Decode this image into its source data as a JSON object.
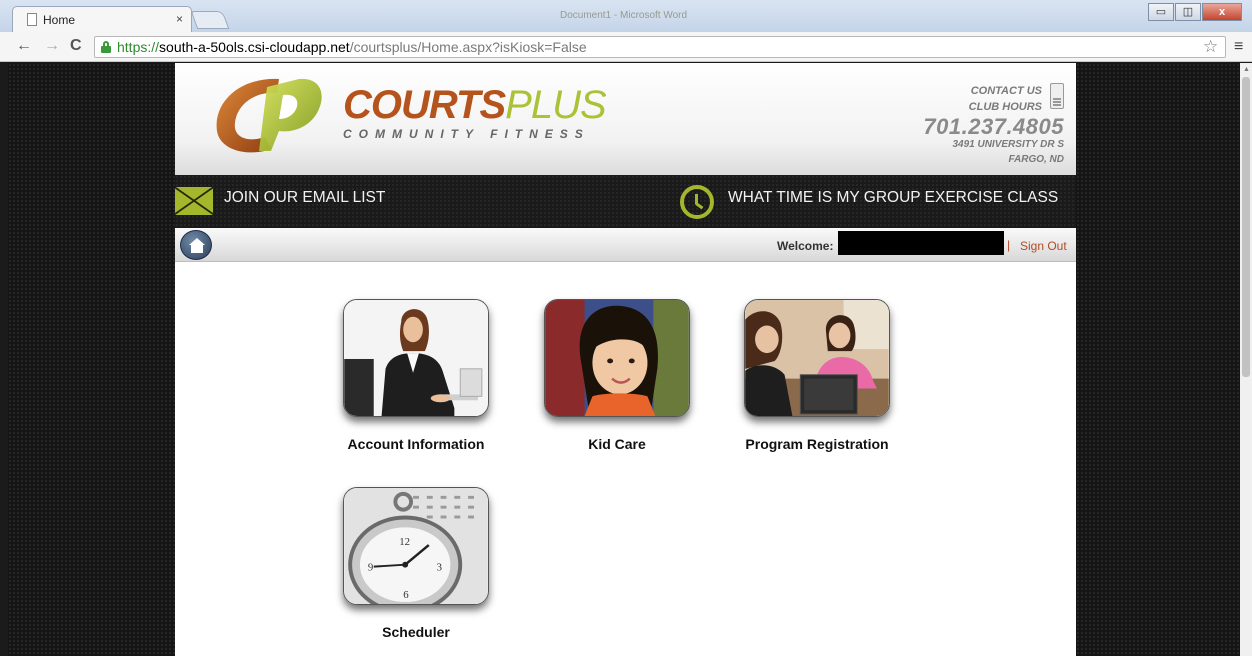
{
  "browser": {
    "tab_title": "Home",
    "tab_close": "×",
    "ghost_title": "Document1 - Microsoft Word",
    "window_buttons": {
      "minimize": "▭",
      "restore": "◫",
      "close": "x"
    },
    "back": "←",
    "forward": "→",
    "reload": "C",
    "url_scheme": "https://",
    "url_host": "south-a-50ols.csi-cloudapp.net",
    "url_path": "/courtsplus/Home.aspx?isKiosk=False",
    "star": "☆",
    "menu": "≡"
  },
  "header": {
    "brand_main": "COURTS",
    "brand_accent": "PLUS",
    "brand_tagline": "COMMUNITY FITNESS",
    "contact_us": "CONTACT US",
    "club_hours": "CLUB HOURS",
    "phone": "701.237.4805",
    "address_line1": "3491 UNIVERSITY DR S",
    "address_line2": "FARGO, ND"
  },
  "promo": {
    "email_list": "JOIN OUR EMAIL LIST",
    "class_time": "WHAT TIME IS MY GROUP EXERCISE CLASS"
  },
  "navbar": {
    "welcome": "Welcome:",
    "separator": "|",
    "sign_out": "Sign Out"
  },
  "tiles": [
    {
      "label": "Account Information",
      "icon": "businesswoman-photo"
    },
    {
      "label": "Kid Care",
      "icon": "child-photo"
    },
    {
      "label": "Program Registration",
      "icon": "registration-desk-photo"
    },
    {
      "label": "Scheduler",
      "icon": "stopwatch-photo"
    }
  ],
  "colors": {
    "brand_orange": "#b4541c",
    "brand_green": "#a9c236",
    "promo_icon_green": "#a3b62c",
    "sign_out": "#b44a24",
    "page_background": "#151515"
  }
}
